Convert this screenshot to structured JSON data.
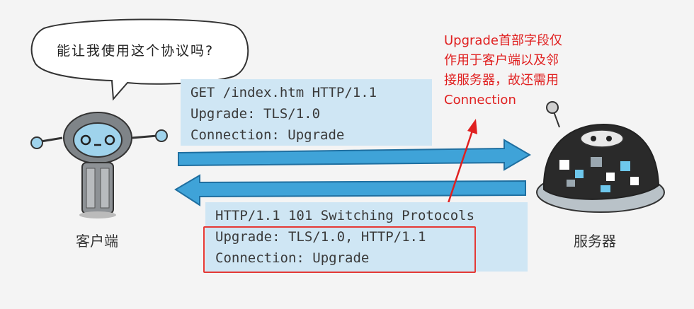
{
  "speech_bubble": {
    "text": "能让我使用这个协议吗?"
  },
  "request": {
    "lines": [
      "GET /index.htm HTTP/1.1",
      "Upgrade: TLS/1.0",
      "Connection: Upgrade"
    ]
  },
  "response": {
    "lines": [
      "HTTP/1.1 101 Switching Protocols",
      "Upgrade: TLS/1.0, HTTP/1.1",
      "Connection: Upgrade"
    ]
  },
  "annotation": {
    "lines": [
      "Upgrade首部字段仅",
      "作用于客户端以及邻",
      "接服务器，故还需用",
      "Connection"
    ]
  },
  "labels": {
    "client": "客户端",
    "server": "服务器"
  },
  "colors": {
    "box_bg": "#cfe6f4",
    "arrow_fill": "#3fa3d8",
    "annotation": "#e02020",
    "highlight": "#e53935"
  }
}
